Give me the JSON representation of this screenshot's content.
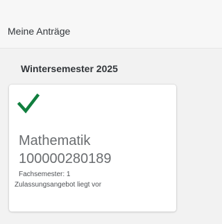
{
  "header": {
    "title": "Meine Anträge"
  },
  "section": {
    "title": "Wintersemester 2025"
  },
  "application_card": {
    "status_icon": "checkmark-icon",
    "status_icon_color": "#107e3e",
    "subject": "Mathematik",
    "application_number": "100000280189",
    "semester_info": "Fachsemester: 1",
    "status_text": "Zulassungsangebot liegt vor"
  }
}
